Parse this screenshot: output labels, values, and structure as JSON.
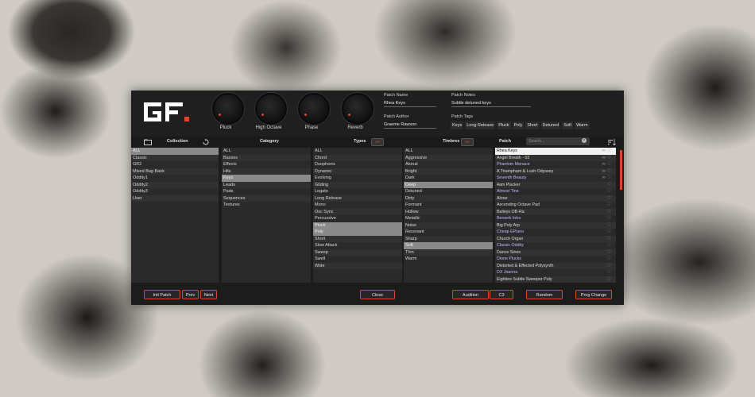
{
  "knobs": [
    {
      "label": "Pluck"
    },
    {
      "label": "High Octave"
    },
    {
      "label": "Phase"
    },
    {
      "label": "Reverb"
    }
  ],
  "meta": {
    "patch_name_label": "Patch Name",
    "patch_name": "Rhea Keys",
    "patch_author_label": "Patch Author",
    "patch_author": "Graeme Rawson",
    "patch_notes_label": "Patch Notes",
    "patch_notes": "Subtle detuned keys",
    "patch_tags_label": "Patch Tags",
    "tags": [
      "Keys",
      "Long Release",
      "Pluck",
      "Poly",
      "Short",
      "Detuned",
      "Soft",
      "Warm"
    ]
  },
  "headers": {
    "collection": "Collection",
    "category": "Category",
    "types": "Types",
    "timbres": "Timbres",
    "patch": "Patch",
    "types_toggle": "OR",
    "timbres_toggle": "OR",
    "search_placeholder": "Search..."
  },
  "collection": [
    "ALL",
    "Classic",
    "GR2",
    "Mixed Bag Bank",
    "Oddity1",
    "Oddity2",
    "Oddity3",
    "User"
  ],
  "category": [
    "ALL",
    "Basses",
    "Effects",
    "Hits",
    "Keys",
    "Leads",
    "Pads",
    "Sequences",
    "Textures"
  ],
  "types": [
    "ALL",
    "Chord",
    "Duophonic",
    "Dynamic",
    "Evolving",
    "Gliding",
    "Legato",
    "Long Release",
    "Mono",
    "Osc Sync",
    "Percussive",
    "Pluck",
    "Poly",
    "Short",
    "Slow Attack",
    "Sweep",
    "Swell",
    "Wide"
  ],
  "timbres": [
    "ALL",
    "Aggressive",
    "Atonal",
    "Bright",
    "Dark",
    "Deep",
    "Detuned",
    "Dirty",
    "Formant",
    "Hollow",
    "Metallic",
    "Noise",
    "Resonant",
    "Sharp",
    "Soft",
    "Thin",
    "Warm"
  ],
  "patches": [
    {
      "name": "Rhea Keys",
      "linked": true
    },
    {
      "name": "Angel Breath - 03",
      "linked": true
    },
    {
      "name": "Phantom Menace",
      "linked": true
    },
    {
      "name": "A Triumphant & Lush Odyssey",
      "linked": true
    },
    {
      "name": "Seventh Beauty",
      "linked": true
    },
    {
      "name": "4am Plucker",
      "linked": false
    },
    {
      "name": "Almost Tine",
      "linked": false
    },
    {
      "name": "Alone",
      "linked": false
    },
    {
      "name": "Ascending Octave Pad",
      "linked": false
    },
    {
      "name": "Balleys OB-Ra",
      "linked": false
    },
    {
      "name": "Berserk Intro",
      "linked": false
    },
    {
      "name": "Big Poly Arp",
      "linked": false
    },
    {
      "name": "Cheap EPiano",
      "linked": false
    },
    {
      "name": "Church Organ",
      "linked": false
    },
    {
      "name": "Classic Oddity",
      "linked": false
    },
    {
      "name": "Dance Sines",
      "linked": false
    },
    {
      "name": "Dione Plucks",
      "linked": false
    },
    {
      "name": "Distorted & Effected Polysynth",
      "linked": false
    },
    {
      "name": "DX Joanna",
      "linked": false
    },
    {
      "name": "Eighties Subtle Sweeper Poly",
      "linked": false
    }
  ],
  "buttons": {
    "init": "Init Patch",
    "prev": "Prev",
    "next": "Next",
    "close": "Close",
    "audition": "Audition",
    "random": "Random",
    "prog_change": "Prog Change",
    "audition_note": "C3"
  }
}
